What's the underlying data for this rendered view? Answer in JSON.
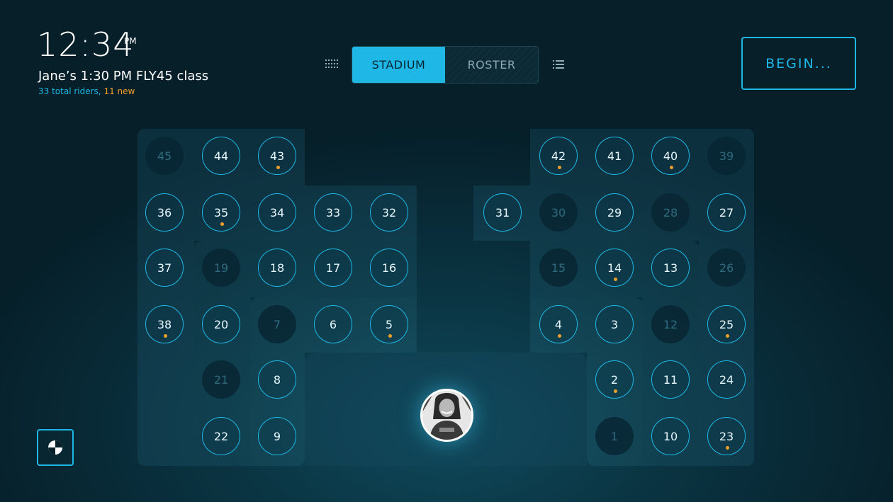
{
  "header": {
    "time": "12:34",
    "ampm": "PM",
    "class_title": "Jane’s 1:30 PM FLY45 class",
    "total_riders": "33 total riders,",
    "new_riders": "11 new"
  },
  "view_toggle": {
    "stadium_label": "STADIUM",
    "roster_label": "ROSTER",
    "selected": "STADIUM"
  },
  "begin_button": {
    "label": "BEGIN..."
  },
  "icons": {
    "grid_view": "grid-dots-icon",
    "list_view": "list-icon",
    "corner": "half-filled-circle-icon"
  },
  "colors": {
    "accent": "#1fb8e6",
    "new_rider": "#f0a029",
    "background": "#0a3442"
  },
  "seats": [
    {
      "n": "45",
      "taken": false,
      "new": false
    },
    {
      "n": "44",
      "taken": true,
      "new": false
    },
    {
      "n": "43",
      "taken": true,
      "new": true
    },
    {
      "n": "42",
      "taken": true,
      "new": true
    },
    {
      "n": "41",
      "taken": true,
      "new": false
    },
    {
      "n": "40",
      "taken": true,
      "new": true
    },
    {
      "n": "39",
      "taken": false,
      "new": false
    },
    {
      "n": "36",
      "taken": true,
      "new": false
    },
    {
      "n": "35",
      "taken": true,
      "new": true
    },
    {
      "n": "34",
      "taken": true,
      "new": false
    },
    {
      "n": "33",
      "taken": true,
      "new": false
    },
    {
      "n": "32",
      "taken": true,
      "new": false
    },
    {
      "n": "31",
      "taken": true,
      "new": false
    },
    {
      "n": "30",
      "taken": false,
      "new": false
    },
    {
      "n": "29",
      "taken": true,
      "new": false
    },
    {
      "n": "28",
      "taken": false,
      "new": false
    },
    {
      "n": "27",
      "taken": true,
      "new": false
    },
    {
      "n": "37",
      "taken": true,
      "new": false
    },
    {
      "n": "19",
      "taken": false,
      "new": false
    },
    {
      "n": "18",
      "taken": true,
      "new": false
    },
    {
      "n": "17",
      "taken": true,
      "new": false
    },
    {
      "n": "16",
      "taken": true,
      "new": false
    },
    {
      "n": "15",
      "taken": false,
      "new": false
    },
    {
      "n": "14",
      "taken": true,
      "new": true
    },
    {
      "n": "13",
      "taken": true,
      "new": false
    },
    {
      "n": "26",
      "taken": false,
      "new": false
    },
    {
      "n": "38",
      "taken": true,
      "new": true
    },
    {
      "n": "20",
      "taken": true,
      "new": false
    },
    {
      "n": "7",
      "taken": false,
      "new": false
    },
    {
      "n": "6",
      "taken": true,
      "new": false
    },
    {
      "n": "5",
      "taken": true,
      "new": true
    },
    {
      "n": "4",
      "taken": true,
      "new": true
    },
    {
      "n": "3",
      "taken": true,
      "new": false
    },
    {
      "n": "12",
      "taken": false,
      "new": false
    },
    {
      "n": "25",
      "taken": true,
      "new": true
    },
    {
      "n": "21",
      "taken": false,
      "new": false
    },
    {
      "n": "8",
      "taken": true,
      "new": false
    },
    {
      "n": "2",
      "taken": true,
      "new": true
    },
    {
      "n": "11",
      "taken": true,
      "new": false
    },
    {
      "n": "24",
      "taken": true,
      "new": false
    },
    {
      "n": "22",
      "taken": true,
      "new": false
    },
    {
      "n": "9",
      "taken": true,
      "new": false
    },
    {
      "n": "1",
      "taken": false,
      "new": false
    },
    {
      "n": "10",
      "taken": true,
      "new": false
    },
    {
      "n": "23",
      "taken": true,
      "new": true
    }
  ]
}
